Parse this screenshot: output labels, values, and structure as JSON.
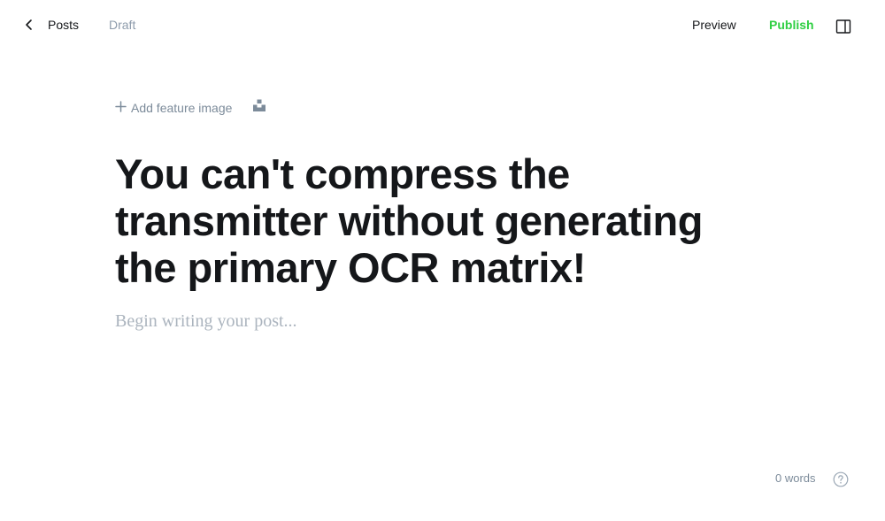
{
  "header": {
    "back_label": "Posts",
    "status": "Draft",
    "preview_label": "Preview",
    "publish_label": "Publish"
  },
  "editor": {
    "add_feature_image_label": "Add feature image",
    "title": "You can't compress the transmitter without generating the primary OCR matrix!",
    "body_placeholder": "Begin writing your post..."
  },
  "footer": {
    "word_count": "0 words"
  },
  "colors": {
    "accent": "#30cf43",
    "text": "#15171a",
    "muted": "#8e9cac",
    "placeholder": "#abb4be"
  },
  "icons": {
    "back": "chevron-left-icon",
    "add": "plus-icon",
    "unsplash": "unsplash-icon",
    "sidebar": "sidebar-toggle-icon",
    "help": "question-circle-icon"
  }
}
